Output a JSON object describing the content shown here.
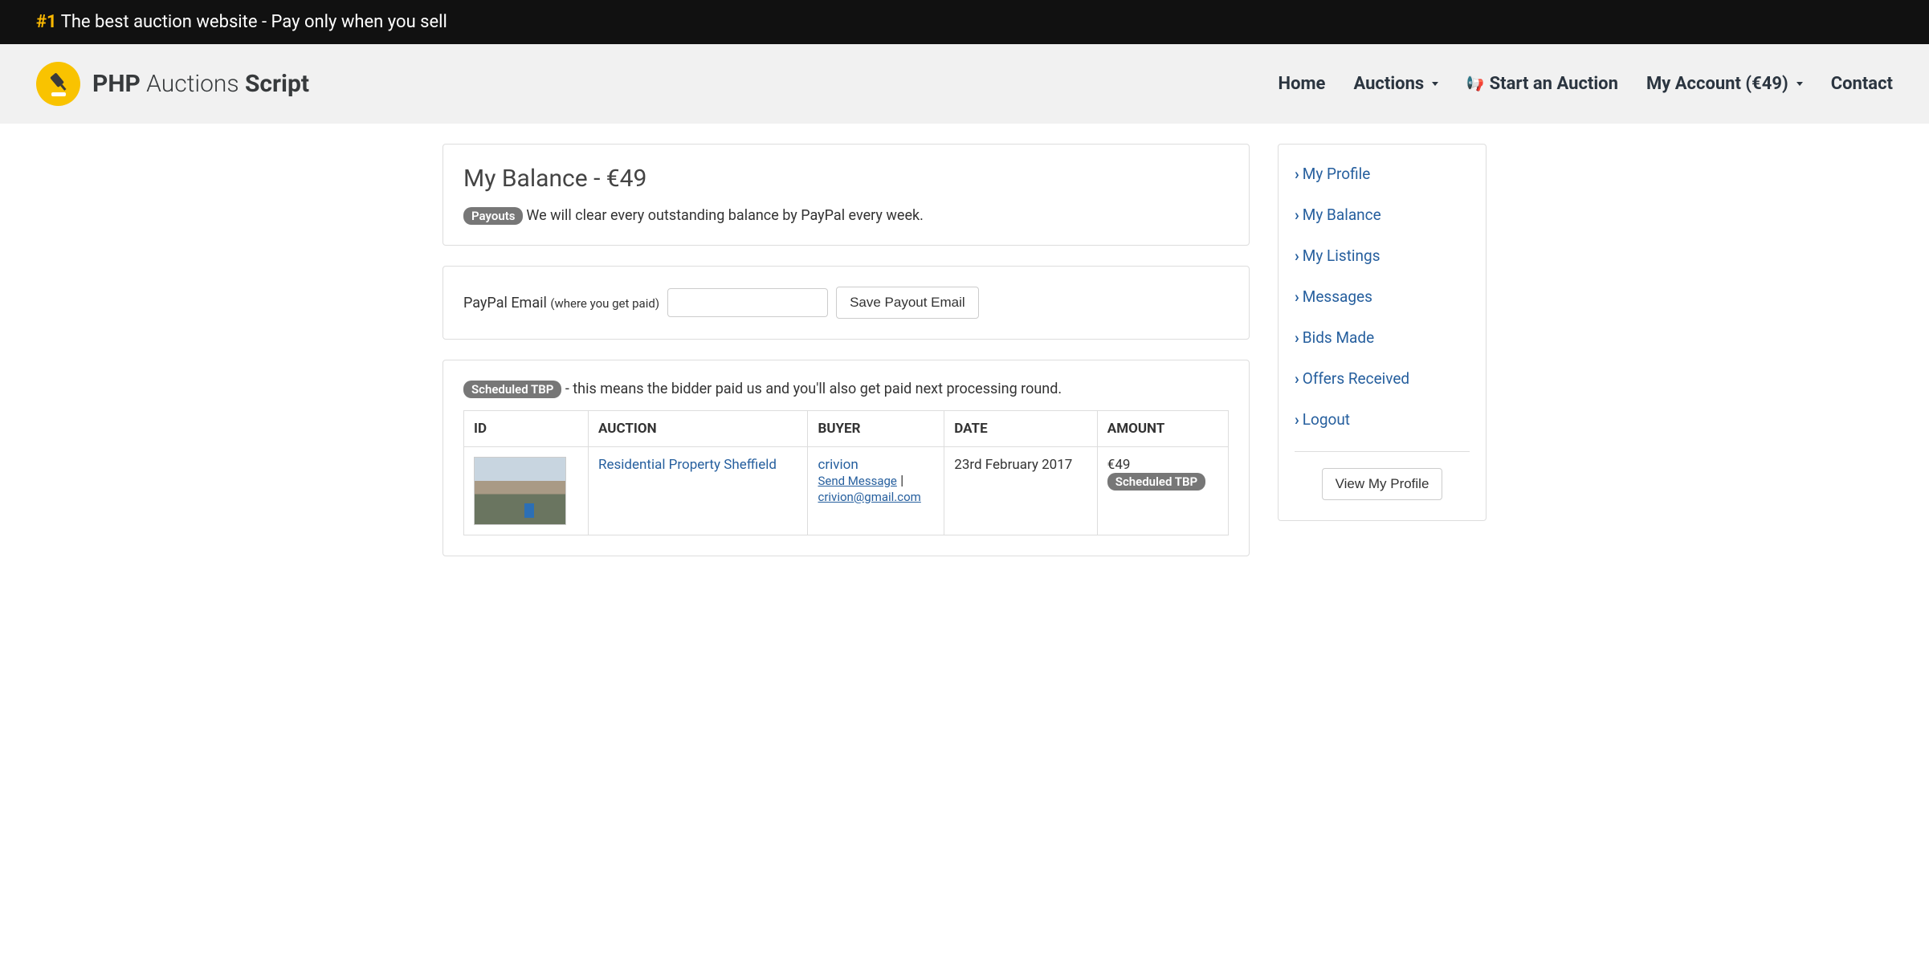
{
  "banner": {
    "hash": "#1",
    "text": "The best auction website - Pay only when you sell"
  },
  "brand": {
    "part1": "PHP",
    "part2": "Auctions",
    "part3": "Script"
  },
  "nav": {
    "home": "Home",
    "auctions": "Auctions",
    "start": "Start an Auction",
    "account": "My Account (€49)",
    "contact": "Contact"
  },
  "balance": {
    "title": "My Balance - €49",
    "badge": "Payouts",
    "desc": "We will clear every outstanding balance by PayPal every week."
  },
  "payout_form": {
    "label_main": "PayPal Email ",
    "label_sub": "(where you get paid)",
    "value": "",
    "save_button": "Save Payout Email"
  },
  "scheduled": {
    "badge": "Scheduled TBP",
    "desc": " - this means the bidder paid us and you'll also get paid next processing round."
  },
  "table": {
    "headers": {
      "id": "ID",
      "auction": "AUCTION",
      "buyer": "BUYER",
      "date": "DATE",
      "amount": "AMOUNT"
    },
    "rows": [
      {
        "auction": "Residential Property Sheffield",
        "buyer_name": "crivion",
        "send_message": "Send Message",
        "pipe": " | ",
        "buyer_email": "crivion@gmail.com",
        "date": "23rd February 2017",
        "amount": "€49",
        "status": "Scheduled TBP"
      }
    ]
  },
  "sidebar": {
    "items": [
      {
        "label": "My Profile"
      },
      {
        "label": "My Balance"
      },
      {
        "label": "My Listings"
      },
      {
        "label": "Messages"
      },
      {
        "label": "Bids Made"
      },
      {
        "label": "Offers Received"
      },
      {
        "label": "Logout"
      }
    ],
    "view_profile": "View My Profile"
  }
}
